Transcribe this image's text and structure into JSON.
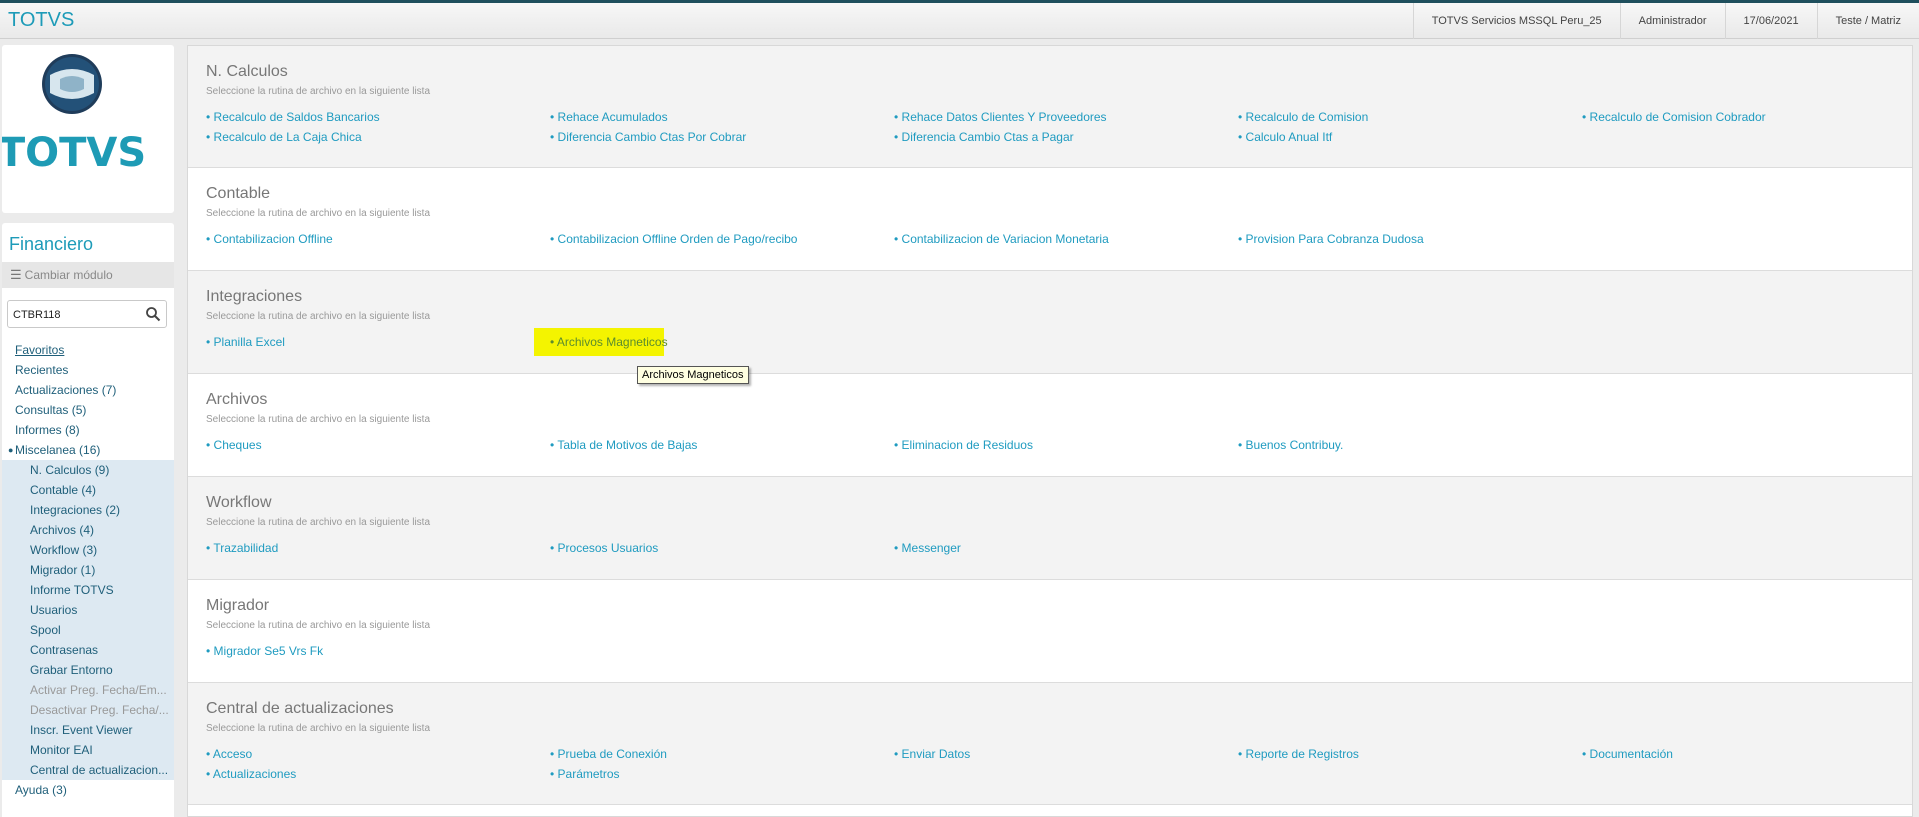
{
  "header": {
    "app_title": "TOTVS",
    "environment": "TOTVS Servicios MSSQL Peru_25",
    "user": "Administrador",
    "date": "17/06/2021",
    "branch": "Teste / Matriz"
  },
  "logo": {
    "text": "TOTVS"
  },
  "sidebar": {
    "module_title": "Financiero",
    "change_module_label": "Cambiar módulo",
    "search_value": "CTBR118",
    "items_top": [
      {
        "label": "Favoritos"
      },
      {
        "label": "Recientes"
      },
      {
        "label": "Actualizaciones (7)"
      },
      {
        "label": "Consultas (5)"
      },
      {
        "label": "Informes (8)"
      },
      {
        "label": "Miscelanea (16)"
      }
    ],
    "sub_items": [
      {
        "label": "N. Calculos (9)"
      },
      {
        "label": "Contable (4)"
      },
      {
        "label": "Integraciones (2)"
      },
      {
        "label": "Archivos (4)"
      },
      {
        "label": "Workflow (3)"
      },
      {
        "label": "Migrador (1)"
      },
      {
        "label": "Informe TOTVS"
      },
      {
        "label": "Usuarios"
      },
      {
        "label": "Spool"
      },
      {
        "label": "Contrasenas"
      },
      {
        "label": "Grabar Entorno"
      },
      {
        "label": "Activar Preg. Fecha/Em..."
      },
      {
        "label": "Desactivar Preg. Fecha/..."
      },
      {
        "label": "Inscr. Event Viewer"
      },
      {
        "label": "Monitor EAI"
      },
      {
        "label": "Central de actualizacion..."
      }
    ],
    "items_bottom": [
      {
        "label": "Ayuda (3)"
      }
    ]
  },
  "sections": [
    {
      "title": "N. Calculos",
      "subtitle": "Seleccione la rutina de archivo en la siguiente lista",
      "links": [
        "• Recalculo de Saldos Bancarios",
        "• Rehace Acumulados",
        "• Rehace Datos Clientes Y Proveedores",
        "• Recalculo de Comision",
        "• Recalculo de Comision Cobrador",
        "• Recalculo de La Caja Chica",
        "• Diferencia Cambio Ctas Por Cobrar",
        "• Diferencia Cambio Ctas a Pagar",
        "• Calculo Anual Itf"
      ]
    },
    {
      "title": "Contable",
      "subtitle": "Seleccione la rutina de archivo en la siguiente lista",
      "links": [
        "• Contabilizacion Offline",
        "• Contabilizacion Offline Orden de Pago/recibo",
        "• Contabilizacion de Variacion Monetaria",
        "• Provision Para Cobranza Dudosa"
      ]
    },
    {
      "title": "Integraciones",
      "subtitle": "Seleccione la rutina de archivo en la siguiente lista",
      "links": [
        "• Planilla Excel",
        "• Archivos Magneticos"
      ]
    },
    {
      "title": "Archivos",
      "subtitle": "Seleccione la rutina de archivo en la siguiente lista",
      "links": [
        "• Cheques",
        "• Tabla de Motivos de Bajas",
        "• Eliminacion de Residuos",
        "• Buenos Contribuy."
      ]
    },
    {
      "title": "Workflow",
      "subtitle": "Seleccione la rutina de archivo en la siguiente lista",
      "links": [
        "• Trazabilidad",
        "• Procesos Usuarios",
        "• Messenger"
      ]
    },
    {
      "title": "Migrador",
      "subtitle": "Seleccione la rutina de archivo en la siguiente lista",
      "links": [
        "• Migrador Se5 Vrs Fk"
      ]
    },
    {
      "title": "Central de actualizaciones",
      "subtitle": "Seleccione la rutina de archivo en la siguiente lista",
      "links": [
        "• Acceso",
        "• Prueba de Conexión",
        "• Enviar Datos",
        "• Reporte de Registros",
        "• Documentación",
        "• Actualizaciones",
        "• Parámetros"
      ]
    }
  ],
  "tooltip": {
    "text": "Archivos Magneticos"
  },
  "colors": {
    "accent": "#1d9bb8",
    "link": "#1f9bc0",
    "highlight": "#f4f400"
  }
}
